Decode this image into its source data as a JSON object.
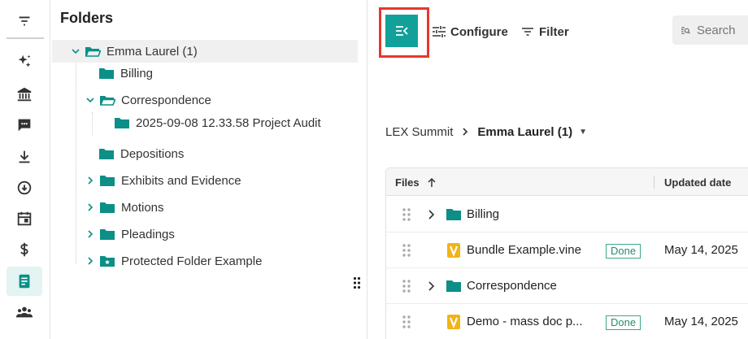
{
  "rail": {
    "items": [
      "filter-icon",
      "sparkle-icon",
      "bank-icon",
      "chat-icon",
      "download-icon",
      "circle-download-icon",
      "calendar-icon",
      "dollar-icon",
      "document-icon",
      "people-icon"
    ],
    "active": "document-icon"
  },
  "folders": {
    "title": "Folders",
    "tree": [
      {
        "label": "Emma Laurel (1)",
        "level": 0,
        "expanded": true,
        "selected": true
      },
      {
        "label": "Billing",
        "level": 1
      },
      {
        "label": "Correspondence",
        "level": 1,
        "expanded": true
      },
      {
        "label": "2025-09-08 12.33.58 Project Audit",
        "level": 2
      },
      {
        "label": "Depositions",
        "level": 1
      },
      {
        "label": "Exhibits and Evidence",
        "level": 1,
        "collapsed": true
      },
      {
        "label": "Motions",
        "level": 1,
        "collapsed": true
      },
      {
        "label": "Pleadings",
        "level": 1,
        "collapsed": true
      },
      {
        "label": "Protected Folder Example",
        "level": 1,
        "collapsed": true,
        "protected": true
      }
    ]
  },
  "toolbar": {
    "configure_label": "Configure",
    "filter_label": "Filter",
    "search_placeholder": "Search"
  },
  "breadcrumb": {
    "root": "LEX Summit",
    "current": "Emma Laurel (1)"
  },
  "table": {
    "col_files": "Files",
    "col_updated": "Updated date",
    "rows": [
      {
        "name": "Billing",
        "type": "folder",
        "status": "",
        "date": ""
      },
      {
        "name": "Bundle Example.vine",
        "type": "vine",
        "status": "Done",
        "date": "May 14, 2025"
      },
      {
        "name": "Correspondence",
        "type": "folder",
        "status": "",
        "date": ""
      },
      {
        "name": "Demo - mass doc p...",
        "type": "vine",
        "status": "Done",
        "date": "May 14, 2025"
      }
    ]
  },
  "colors": {
    "accent": "#11a19a",
    "folder": "#0b8f87",
    "highlight": "#e8372a",
    "vine": "#f2b416"
  }
}
